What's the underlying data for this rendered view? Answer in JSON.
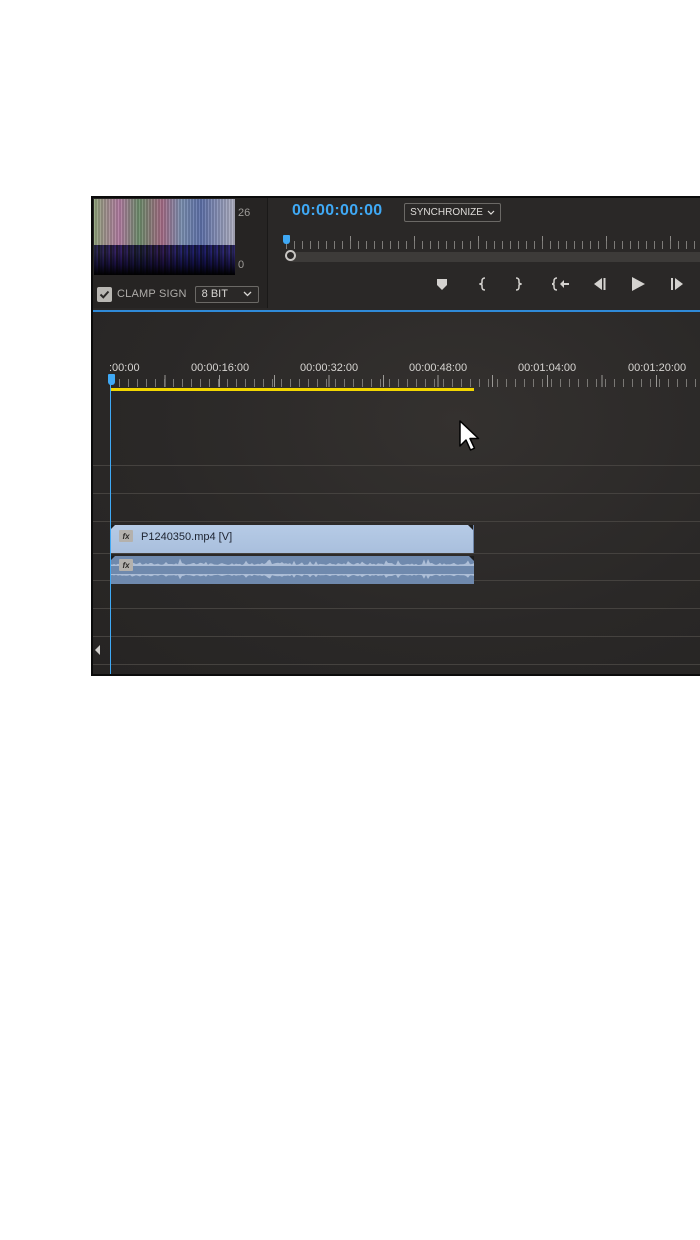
{
  "scope": {
    "top_value": "26",
    "bottom_value": "0",
    "clamp_label": "CLAMP SIGN",
    "clamp_checked": true,
    "bit_depth": "8 BIT"
  },
  "monitor": {
    "timecode": "00:00:00:00",
    "sync_label": "SYNCHRONIZE"
  },
  "transport": [
    {
      "name": "add-marker-button",
      "icon": "marker-icon"
    },
    {
      "name": "mark-in-button",
      "icon": "mark-in-icon"
    },
    {
      "name": "mark-out-button",
      "icon": "mark-out-icon"
    },
    {
      "name": "go-to-in-button",
      "icon": "go-to-in-icon"
    },
    {
      "name": "step-back-button",
      "icon": "step-back-icon"
    },
    {
      "name": "play-button",
      "icon": "play-icon"
    },
    {
      "name": "step-forward-button",
      "icon": "step-forward-icon"
    }
  ],
  "ruler": {
    "labels": [
      ":00:00",
      "00:00:16:00",
      "00:00:32:00",
      "00:00:48:00",
      "00:01:04:00",
      "00:01:20:00"
    ]
  },
  "clips": {
    "video_name": "P1240350.mp4 [V]",
    "video_fx": "fx",
    "audio_fx": "fx"
  },
  "colors": {
    "accent": "#3fa9f5",
    "work_area": "#f2d600",
    "video_clip": "#b6cbe6",
    "audio_clip": "#6f89ad"
  }
}
